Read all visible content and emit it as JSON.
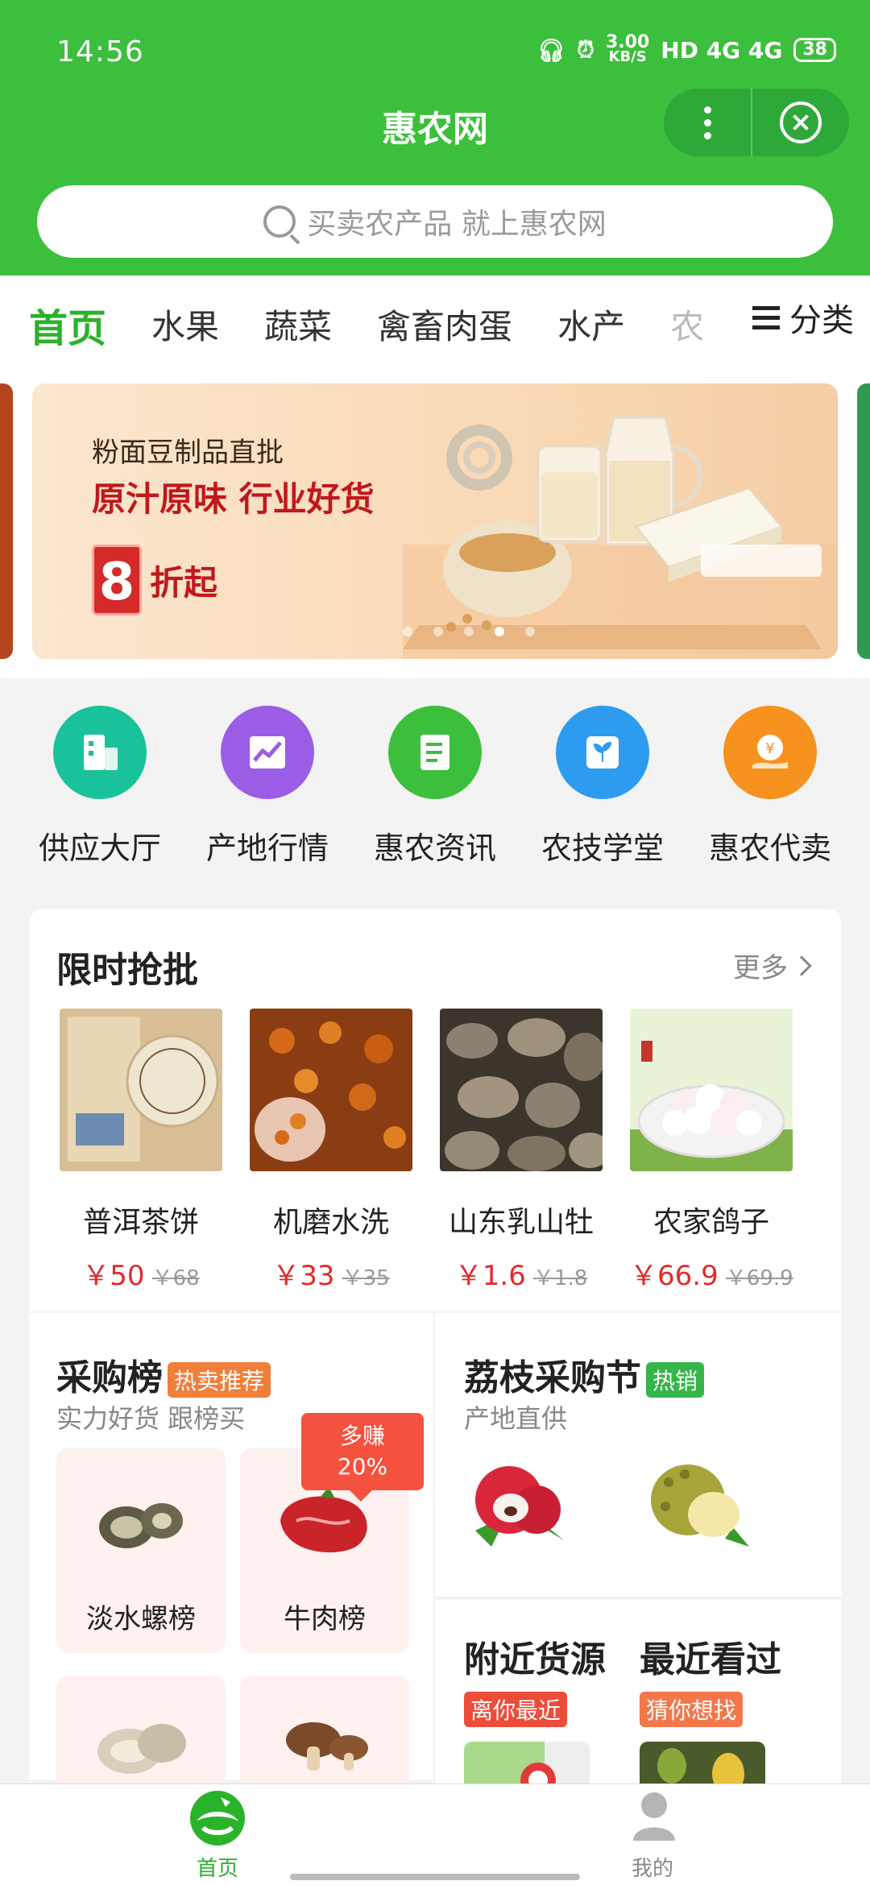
{
  "status_bar": {
    "time": "14:56",
    "speed_value": "3.00",
    "speed_unit": "KB/S",
    "network": "HD 4G 4G",
    "battery": "38"
  },
  "header": {
    "title": "惠农网",
    "search_placeholder": "买卖农产品 就上惠农网"
  },
  "tabs": {
    "items": [
      "首页",
      "水果",
      "蔬菜",
      "禽畜肉蛋",
      "水产",
      "农"
    ],
    "active": "首页",
    "category_label": "分类"
  },
  "banner": {
    "line1": "粉面豆制品直批",
    "line2": "原汁原味 行业好货",
    "discount_number": "8",
    "discount_unit": "折起",
    "dots_count": 5,
    "active_dot": 4
  },
  "shortcuts": [
    {
      "label": "供应大厅",
      "icon": "building-icon",
      "color": "#19c29a"
    },
    {
      "label": "产地行情",
      "icon": "chart-trend-icon",
      "color": "#9b5de5"
    },
    {
      "label": "惠农资讯",
      "icon": "document-icon",
      "color": "#3cbf3c"
    },
    {
      "label": "农技学堂",
      "icon": "book-plant-icon",
      "color": "#2d9bf0"
    },
    {
      "label": "惠农代卖",
      "icon": "yen-hand-icon",
      "color": "#f7921e"
    }
  ],
  "flash_sale": {
    "title": "限时抢批",
    "more_label": "更多",
    "products": [
      {
        "name": "普洱茶饼",
        "price": "￥50",
        "old_price": "￥68"
      },
      {
        "name": "机磨水洗",
        "price": "￥33",
        "old_price": "￥35"
      },
      {
        "name": "山东乳山牡",
        "price": "￥1.6",
        "old_price": "￥1.8"
      },
      {
        "name": "农家鸽子",
        "price": "￥66.9",
        "old_price": "￥69.9"
      }
    ]
  },
  "purchase_rank": {
    "title": "采购榜",
    "tag": "热卖推荐",
    "subtitle": "实力好货 跟榜买",
    "promo_line1": "多赚",
    "promo_line2": "20%",
    "cards": [
      {
        "label": "淡水螺榜"
      },
      {
        "label": "牛肉榜"
      },
      {
        "label": ""
      },
      {
        "label": ""
      }
    ]
  },
  "lychee_festival": {
    "title": "荔枝采购节",
    "tag": "热销",
    "subtitle": "产地直供"
  },
  "nearby": {
    "title": "附近货源",
    "tag": "离你最近"
  },
  "recent": {
    "title": "最近看过",
    "tag": "猜你想找"
  },
  "tabbar": {
    "home_label": "首页",
    "mine_label": "我的",
    "active_color": "#2bb22b"
  }
}
